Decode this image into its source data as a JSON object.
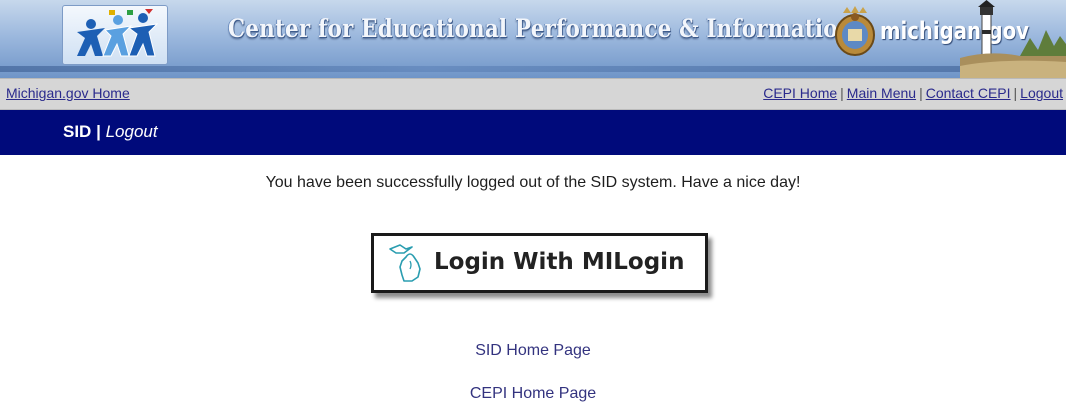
{
  "header": {
    "title": "Center for Educational Performance & Information",
    "state_brand": "michigan.gov",
    "logo_icon": "cepi-people-logo-icon",
    "seal_icon": "michigan-seal-icon",
    "lighthouse_icon": "lighthouse-icon"
  },
  "top_links": {
    "home": "Michigan.gov Home",
    "cepi_home": "CEPI Home",
    "main_menu": "Main Menu",
    "contact": "Contact CEPI",
    "logout": "Logout",
    "separator": "|"
  },
  "nav": {
    "system": "SID",
    "separator": "|",
    "page": "Logout"
  },
  "main": {
    "message": "You have been successfully logged out of the SID system. Have a nice day!",
    "login_button": "Login With MILogin",
    "sid_home_link": "SID Home Page",
    "cepi_home_link": "CEPI Home Page"
  },
  "colors": {
    "navbar": "#000a7b",
    "linkbar": "#d6d6d6",
    "link": "#2a2a8c",
    "banner": "#9db9de"
  }
}
